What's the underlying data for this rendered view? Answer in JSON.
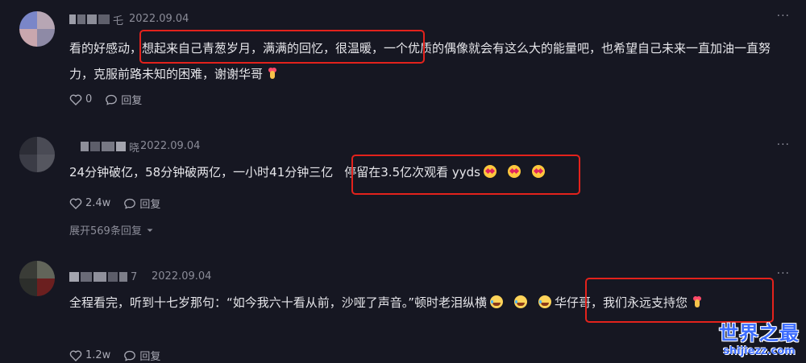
{
  "comments": [
    {
      "username_visible_tail": "乇",
      "date": "2022.09.04",
      "text_before": "看的好感动，",
      "text_highlight": "想起来自己青葱岁月，满满的回忆，很温暖，",
      "text_after": "一个优质的偶像就会有这么大的能量吧，也希望自己未来一直加油一直努力，克服前路未知的困难，谢谢华哥",
      "trailing_emoji": "heart-hands",
      "likes": "0",
      "reply_label": "回复"
    },
    {
      "username_visible_tail": "晓",
      "date": "2022.09.04",
      "text_before": "24分钟破亿，58分钟破两亿，一小时41分钟三亿",
      "text_highlight": "停留在3.5亿次观看 yyds",
      "highlight_emojis": [
        "star-struck",
        "star-struck",
        "star-struck"
      ],
      "likes": "2.4w",
      "reply_label": "回复",
      "expand_replies": "展开569条回复"
    },
    {
      "username_visible_tail": "7",
      "date": "2022.09.04",
      "text_before": "全程看完，听到十七岁那句：“如今我六十看从前，沙哑了声音。”顿时老泪纵横",
      "before_emojis": [
        "tears-of-joy",
        "tears-of-joy"
      ],
      "highlight_emojis": [
        "tears-of-joy"
      ],
      "text_highlight": "华仔哥，我们永远支持您",
      "trailing_emoji": "heart-hands",
      "likes": "1.2w",
      "reply_label": "回复"
    }
  ],
  "more_label": "···",
  "watermark": {
    "title": "世界之最",
    "url": "shijiezz.com"
  },
  "colors": {
    "background": "#161722",
    "text": "#e6e6ea",
    "muted": "#8b8c98",
    "highlight_border": "#e3221c",
    "watermark": "#3c6cff"
  }
}
